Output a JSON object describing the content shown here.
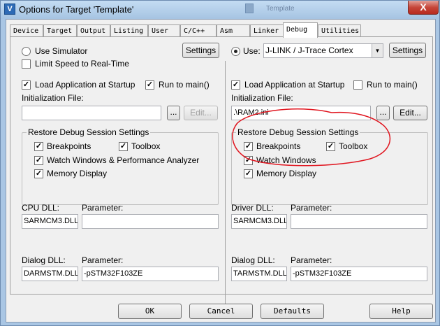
{
  "window": {
    "title": "Options for Target 'Template'",
    "background_title": "Template",
    "close_label": "X",
    "app_icon": "V"
  },
  "tabs": [
    "Device",
    "Target",
    "Output",
    "Listing",
    "User",
    "C/C++",
    "Asm",
    "Linker",
    "Debug",
    "Utilities"
  ],
  "active_tab": "Debug",
  "left": {
    "use_simulator": "Use Simulator",
    "limit_speed": "Limit Speed to Real-Time",
    "settings": "Settings",
    "load_app": "Load Application at Startup",
    "run_to_main": "Run to main()",
    "init_file_label": "Initialization File:",
    "init_file_value": "",
    "browse": "...",
    "edit": "Edit...",
    "restore_group": "Restore Debug Session Settings",
    "breakpoints": "Breakpoints",
    "toolbox": "Toolbox",
    "watch_windows": "Watch Windows & Performance Analyzer",
    "memory_display": "Memory Display",
    "cpu_dll_label": "CPU DLL:",
    "cpu_param_label": "Parameter:",
    "cpu_dll": "SARMCM3.DLL",
    "cpu_param": "",
    "dialog_dll_label": "Dialog DLL:",
    "dialog_param_label": "Parameter:",
    "dialog_dll": "DARMSTM.DLL",
    "dialog_param": "-pSTM32F103ZE"
  },
  "right": {
    "use": "Use:",
    "debugger": "J-LINK / J-Trace Cortex",
    "settings": "Settings",
    "load_app": "Load Application at Startup",
    "run_to_main": "Run to main()",
    "init_file_label": "Initialization File:",
    "init_file_value": ".\\RAM2.ini",
    "browse": "...",
    "edit": "Edit...",
    "restore_group": "Restore Debug Session Settings",
    "breakpoints": "Breakpoints",
    "toolbox": "Toolbox",
    "watch_windows": "Watch Windows",
    "memory_display": "Memory Display",
    "driver_dll_label": "Driver DLL:",
    "driver_param_label": "Parameter:",
    "driver_dll": "SARMCM3.DLL",
    "driver_param": "",
    "dialog_dll_label": "Dialog DLL:",
    "dialog_param_label": "Parameter:",
    "dialog_dll": "TARMSTM.DLL",
    "dialog_param": "-pSTM32F103ZE"
  },
  "footer": {
    "ok": "OK",
    "cancel": "Cancel",
    "defaults": "Defaults",
    "help": "Help"
  },
  "check_mark": "✓",
  "colors": {
    "annotation": "#e0141e",
    "titlebar": "#a9c6e4",
    "close": "#c6463a"
  }
}
